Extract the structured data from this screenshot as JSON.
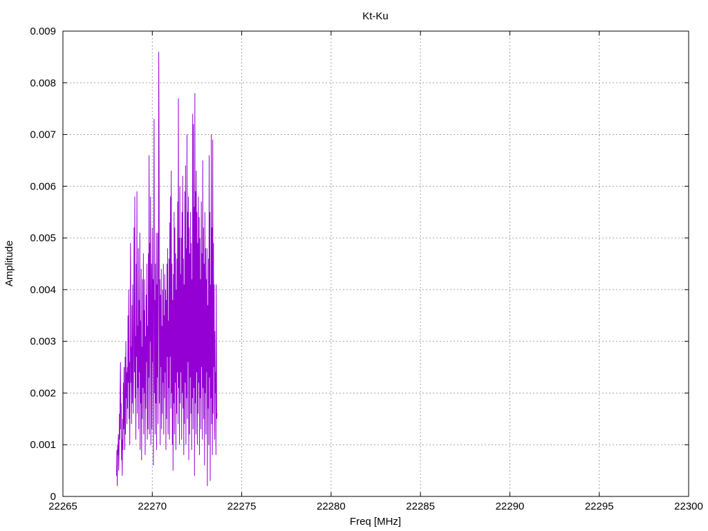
{
  "chart_data": {
    "type": "line",
    "title": "Kt-Ku",
    "xlabel": "Freq [MHz]",
    "ylabel": "Amplitude",
    "xlim": [
      22265,
      22300
    ],
    "ylim": [
      0,
      0.009
    ],
    "x_ticks": [
      "22265",
      "22270",
      "22275",
      "22280",
      "22285",
      "22290",
      "22295",
      "22300"
    ],
    "y_ticks": [
      "0",
      "0.001",
      "0.002",
      "0.003",
      "0.004",
      "0.005",
      "0.006",
      "0.007",
      "0.008",
      "0.009"
    ],
    "grid": true,
    "line_color": "#9400d3",
    "series": [
      {
        "x_start": 22268.0,
        "x_step": 0.02,
        "values": [
          0.0004,
          0.0009,
          0.0002,
          0.001,
          0.0008,
          0.0012,
          0.0005,
          0.0009,
          0.0016,
          0.0011,
          0.002,
          0.0026,
          0.0013,
          0.0018,
          0.0007,
          0.0011,
          0.0004,
          0.0015,
          0.0009,
          0.0022,
          0.0013,
          0.0025,
          0.0016,
          0.0009,
          0.0027,
          0.0012,
          0.003,
          0.0019,
          0.0024,
          0.0014,
          0.0025,
          0.0017,
          0.0035,
          0.0022,
          0.004,
          0.0015,
          0.0026,
          0.001,
          0.0032,
          0.0049,
          0.0022,
          0.0029,
          0.0014,
          0.0037,
          0.0018,
          0.0041,
          0.0025,
          0.0016,
          0.0034,
          0.0052,
          0.0024,
          0.0058,
          0.0019,
          0.0031,
          0.0011,
          0.0045,
          0.0027,
          0.0059,
          0.0016,
          0.0033,
          0.0021,
          0.0048,
          0.0013,
          0.0038,
          0.0024,
          0.0051,
          0.0009,
          0.0034,
          0.0018,
          0.0044,
          0.0007,
          0.0029,
          0.0015,
          0.0042,
          0.0021,
          0.0047,
          0.0012,
          0.0036,
          0.002,
          0.0042,
          0.0008,
          0.0031,
          0.0017,
          0.0039,
          0.0026,
          0.0045,
          0.0011,
          0.0033,
          0.0013,
          0.0047,
          0.0023,
          0.0066,
          0.0012,
          0.0049,
          0.003,
          0.0058,
          0.001,
          0.0035,
          0.0045,
          0.0013,
          0.0052,
          0.0026,
          0.0042,
          0.0006,
          0.005,
          0.0073,
          0.002,
          0.0038,
          0.0012,
          0.0045,
          0.0018,
          0.0051,
          0.0009,
          0.0041,
          0.0023,
          0.0051,
          0.0014,
          0.0036,
          0.0086,
          0.0064,
          0.0018,
          0.0042,
          0.001,
          0.0039,
          0.0025,
          0.0044,
          0.0013,
          0.0033,
          0.0016,
          0.004,
          0.0022,
          0.0045,
          0.0012,
          0.0035,
          0.0019,
          0.0043,
          0.0024,
          0.004,
          0.0009,
          0.0038,
          0.0015,
          0.0045,
          0.0027,
          0.0048,
          0.0012,
          0.0034,
          0.0021,
          0.0046,
          0.0011,
          0.0053,
          0.0027,
          0.0058,
          0.0017,
          0.0063,
          0.002,
          0.0045,
          0.001,
          0.0038,
          0.0005,
          0.0043,
          0.0018,
          0.0055,
          0.0012,
          0.0052,
          0.0022,
          0.0047,
          0.0009,
          0.004,
          0.0016,
          0.0046,
          0.0024,
          0.0057,
          0.0014,
          0.0077,
          0.0021,
          0.005,
          0.001,
          0.006,
          0.0018,
          0.0043,
          0.0024,
          0.005,
          0.0011,
          0.0055,
          0.002,
          0.0062,
          0.0017,
          0.0046,
          0.0008,
          0.0041,
          0.0014,
          0.0059,
          0.0022,
          0.0064,
          0.001,
          0.0048,
          0.0019,
          0.007,
          0.0015,
          0.0055,
          0.0026,
          0.0058,
          0.0007,
          0.0052,
          0.0012,
          0.0047,
          0.0023,
          0.0055,
          0.0016,
          0.0049,
          0.0009,
          0.0042,
          0.0019,
          0.0074,
          0.0013,
          0.0072,
          0.0021,
          0.0056,
          0.0004,
          0.0078,
          0.0018,
          0.0059,
          0.0012,
          0.0063,
          0.0024,
          0.0055,
          0.001,
          0.0049,
          0.0016,
          0.0058,
          0.0022,
          0.0054,
          0.0008,
          0.005,
          0.0019,
          0.0042,
          0.0013,
          0.0057,
          0.0025,
          0.0047,
          0.0011,
          0.0065,
          0.0021,
          0.0052,
          0.0015,
          0.0045,
          0.0006,
          0.0055,
          0.002,
          0.0048,
          0.0012,
          0.0042,
          0.0024,
          0.0048,
          0.0002,
          0.0037,
          0.0017,
          0.0046,
          0.001,
          0.0066,
          0.0023,
          0.0055,
          0.0003,
          0.0041,
          0.0019,
          0.007,
          0.0014,
          0.0052,
          0.0008,
          0.0069,
          0.0016,
          0.0049,
          0.0025,
          0.0041,
          0.0011,
          0.0032,
          0.002,
          0.0024,
          0.0008,
          0.0041,
          0.0015,
          0.0016
        ]
      }
    ]
  }
}
